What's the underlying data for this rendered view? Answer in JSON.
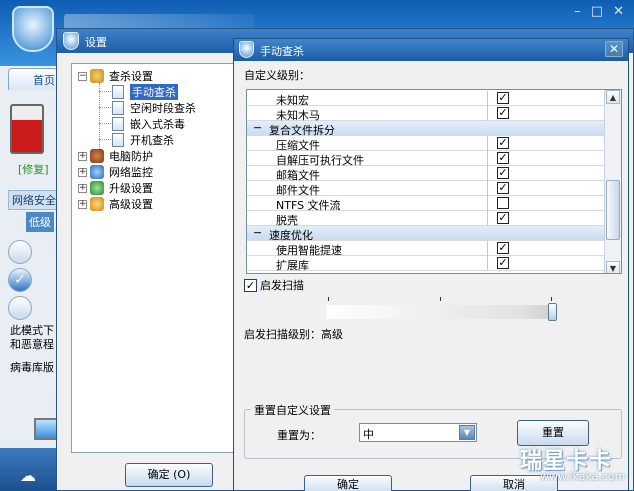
{
  "background_app": {
    "home_tab": "首页",
    "fix_label": "[修复]",
    "network_security": "网络安全",
    "low_label": "低级",
    "desc_line1": "此模式下",
    "desc_line2": "和恶意程",
    "virus_db": "病毒库版",
    "win_buttons": [
      "–",
      "□",
      "✕"
    ]
  },
  "settings_dialog": {
    "title": "设置",
    "ok_button": "确定 (O)",
    "tree": {
      "scan_settings": "查杀设置",
      "manual_scan": "手动查杀",
      "idle_scan": "空闲时段查杀",
      "embedded_scan": "嵌入式杀毒",
      "boot_scan": "开机查杀",
      "pc_protection": "电脑防护",
      "network_monitor": "网络监控",
      "upgrade_settings": "升级设置",
      "advanced_settings": "高级设置"
    }
  },
  "manual_dialog": {
    "title": "手动查杀",
    "close": "✕",
    "custom_level_label": "自定义级别：",
    "rows": [
      {
        "type": "item",
        "name": "未知宏",
        "checked": true
      },
      {
        "type": "item",
        "name": "未知木马",
        "checked": true
      },
      {
        "type": "group",
        "name": "复合文件拆分"
      },
      {
        "type": "item",
        "name": "压缩文件",
        "checked": true
      },
      {
        "type": "item",
        "name": "自解压可执行文件",
        "checked": true
      },
      {
        "type": "item",
        "name": "邮箱文件",
        "checked": true
      },
      {
        "type": "item",
        "name": "邮件文件",
        "checked": true
      },
      {
        "type": "item",
        "name": "NTFS 文件流",
        "checked": false
      },
      {
        "type": "item",
        "name": "脱壳",
        "checked": true
      },
      {
        "type": "group",
        "name": "速度优化"
      },
      {
        "type": "item",
        "name": "使用智能提速",
        "checked": true
      },
      {
        "type": "item",
        "name": "扩展库",
        "checked": true
      }
    ],
    "heuristic_label": "启发扫描",
    "heuristic_checked": true,
    "heuristic_slider_level": 1.0,
    "heuristic_level_text": "启发扫描级别：高级",
    "reset_group_title": "重置自定义设置",
    "reset_to_label": "重置为：",
    "reset_select_value": "中",
    "reset_button": "重置",
    "ok_button": "确定",
    "cancel_button": "取消"
  },
  "watermark": {
    "line1": "瑞星卡卡",
    "line2": "www.ikaka.com"
  },
  "colors": {
    "title_bar": "#1f5ea6",
    "selection": "#316ac5",
    "highlight_ellipse": "#c01818"
  }
}
